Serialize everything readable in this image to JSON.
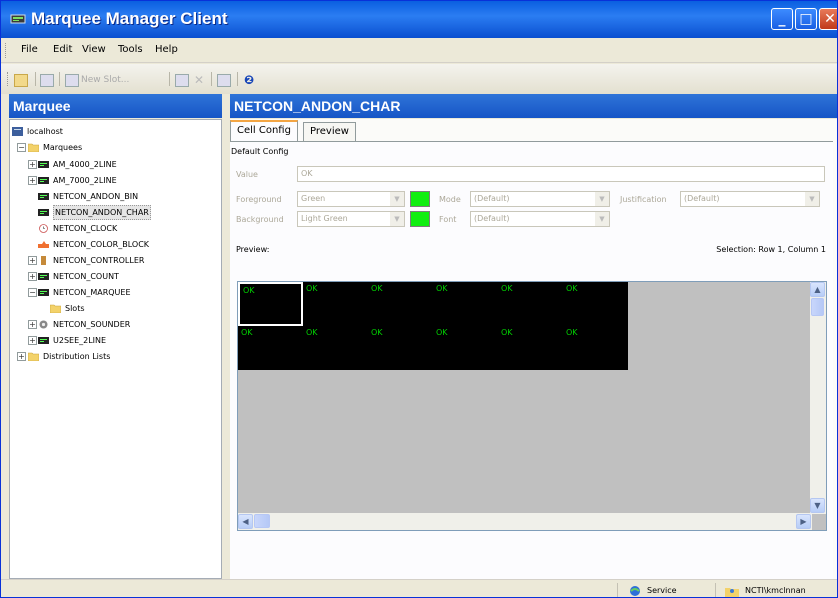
{
  "window": {
    "title": "Marquee Manager Client"
  },
  "menu": [
    "File",
    "Edit",
    "View",
    "Tools",
    "Help"
  ],
  "toolbar": {
    "new_slot_label": "New Slot..."
  },
  "left_pane": {
    "title": "Marquee",
    "tree": {
      "root": "localhost",
      "folder": "Marquees",
      "items": [
        {
          "label": "AM_4000_2LINE",
          "icon": "led-sign-icon"
        },
        {
          "label": "AM_7000_2LINE",
          "icon": "led-sign-icon"
        },
        {
          "label": "NETCON_ANDON_BIN",
          "icon": "led-sign-icon"
        },
        {
          "label": "NETCON_ANDON_CHAR",
          "icon": "led-sign-icon"
        },
        {
          "label": "NETCON_CLOCK",
          "icon": "clock-icon"
        },
        {
          "label": "NETCON_COLOR_BLOCK",
          "icon": "color-block-icon"
        },
        {
          "label": "NETCON_CONTROLLER",
          "icon": "controller-icon"
        },
        {
          "label": "NETCON_COUNT",
          "icon": "led-sign-icon"
        },
        {
          "label": "NETCON_MARQUEE",
          "icon": "led-sign-icon"
        },
        {
          "label": "Slots",
          "icon": "folder-icon"
        },
        {
          "label": "NETCON_SOUNDER",
          "icon": "speaker-icon"
        },
        {
          "label": "U2SEE_2LINE",
          "icon": "led-sign-icon"
        }
      ],
      "distribution": "Distribution Lists"
    }
  },
  "right_pane": {
    "title": "NETCON_ANDON_CHAR",
    "tabs": [
      "Cell Config",
      "Preview"
    ],
    "group_label": "Default Config",
    "value_label": "Value",
    "value": "OK",
    "foreground_label": "Foreground",
    "foreground_value": "Green",
    "background_label": "Background",
    "background_value": "Light Green",
    "mode_label": "Mode",
    "mode_value": "(Default)",
    "font_label": "Font",
    "font_value": "(Default)",
    "justification_label": "Justification",
    "justification_value": "(Default)",
    "preview_label": "Preview:",
    "selection_text": "Selection: Row 1, Column 1",
    "preview_grid": [
      [
        "OK",
        "OK",
        "OK",
        "OK",
        "OK",
        "OK"
      ],
      [
        "OK",
        "OK",
        "OK",
        "OK",
        "OK",
        "OK"
      ]
    ],
    "swatch_color": "#10ee10"
  },
  "status": {
    "service": "Service",
    "user": "NCTI\\kmclnnan"
  }
}
